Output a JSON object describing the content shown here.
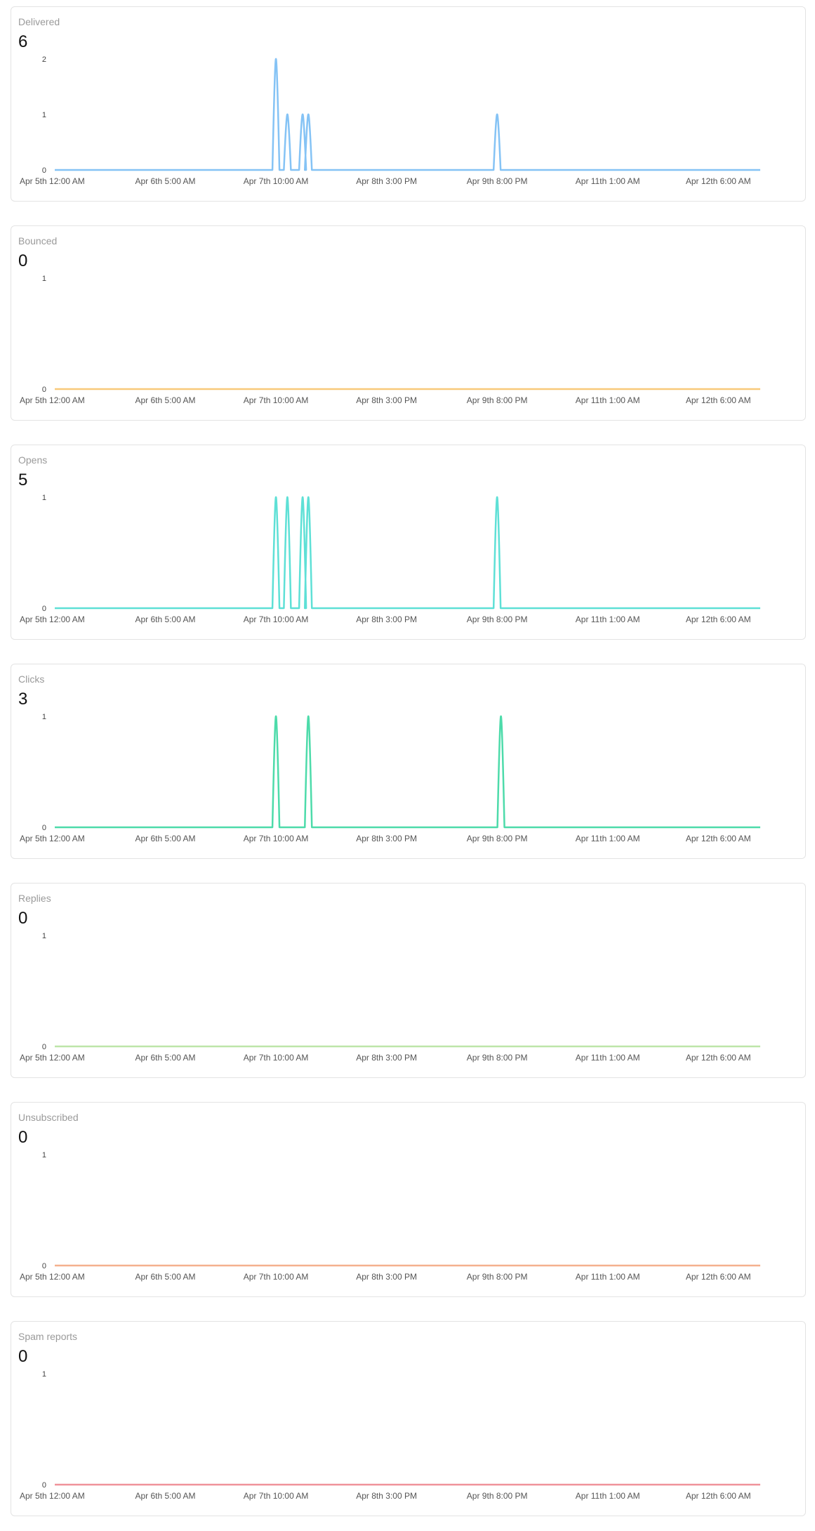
{
  "chart_data": [
    {
      "type": "line",
      "title": "Delivered",
      "total": "6",
      "color": "#85c3f5",
      "x_ticks": [
        "Apr 5th 12:00 AM",
        "Apr 6th 5:00 AM",
        "Apr 7th 10:00 AM",
        "Apr 8th 3:00 PM",
        "Apr 9th 8:00 PM",
        "Apr 11th 1:00 AM",
        "Apr 12th 6:00 AM"
      ],
      "y_ticks": [
        "0",
        "1",
        "2"
      ],
      "ylim": [
        0,
        2
      ],
      "xlim": [
        "Apr 5th 12:00 AM",
        "Apr 12th 5:00 PM"
      ],
      "points": [
        {
          "x": "Apr 7th 10:00 AM",
          "y": 2
        },
        {
          "x": "Apr 7th 1:00 PM",
          "y": 1
        },
        {
          "x": "Apr 7th 5:00 PM",
          "y": 1
        },
        {
          "x": "Apr 7th 6:30 PM",
          "y": 1
        },
        {
          "x": "Apr 9th 8:00 PM",
          "y": 1
        }
      ]
    },
    {
      "type": "line",
      "title": "Bounced",
      "total": "0",
      "color": "#f8c97a",
      "x_ticks": [
        "Apr 5th 12:00 AM",
        "Apr 6th 5:00 AM",
        "Apr 7th 10:00 AM",
        "Apr 8th 3:00 PM",
        "Apr 9th 8:00 PM",
        "Apr 11th 1:00 AM",
        "Apr 12th 6:00 AM"
      ],
      "y_ticks": [
        "0",
        "1"
      ],
      "ylim": [
        0,
        1
      ],
      "xlim": [
        "Apr 5th 12:00 AM",
        "Apr 12th 5:00 PM"
      ],
      "points": []
    },
    {
      "type": "line",
      "title": "Opens",
      "total": "5",
      "color": "#5ee0d6",
      "x_ticks": [
        "Apr 5th 12:00 AM",
        "Apr 6th 5:00 AM",
        "Apr 7th 10:00 AM",
        "Apr 8th 3:00 PM",
        "Apr 9th 8:00 PM",
        "Apr 11th 1:00 AM",
        "Apr 12th 6:00 AM"
      ],
      "y_ticks": [
        "0",
        "1"
      ],
      "ylim": [
        0,
        1
      ],
      "xlim": [
        "Apr 5th 12:00 AM",
        "Apr 12th 5:00 PM"
      ],
      "points": [
        {
          "x": "Apr 7th 10:00 AM",
          "y": 1
        },
        {
          "x": "Apr 7th 1:00 PM",
          "y": 1
        },
        {
          "x": "Apr 7th 5:00 PM",
          "y": 1
        },
        {
          "x": "Apr 7th 6:30 PM",
          "y": 1
        },
        {
          "x": "Apr 9th 8:00 PM",
          "y": 1
        }
      ]
    },
    {
      "type": "line",
      "title": "Clicks",
      "total": "3",
      "color": "#4ddbaa",
      "x_ticks": [
        "Apr 5th 12:00 AM",
        "Apr 6th 5:00 AM",
        "Apr 7th 10:00 AM",
        "Apr 8th 3:00 PM",
        "Apr 9th 8:00 PM",
        "Apr 11th 1:00 AM",
        "Apr 12th 6:00 AM"
      ],
      "y_ticks": [
        "0",
        "1"
      ],
      "ylim": [
        0,
        1
      ],
      "xlim": [
        "Apr 5th 12:00 AM",
        "Apr 12th 5:00 PM"
      ],
      "points": [
        {
          "x": "Apr 7th 10:00 AM",
          "y": 1
        },
        {
          "x": "Apr 7th 6:30 PM",
          "y": 1
        },
        {
          "x": "Apr 9th 9:00 PM",
          "y": 1
        }
      ]
    },
    {
      "type": "line",
      "title": "Replies",
      "total": "0",
      "color": "#bde5a8",
      "x_ticks": [
        "Apr 5th 12:00 AM",
        "Apr 6th 5:00 AM",
        "Apr 7th 10:00 AM",
        "Apr 8th 3:00 PM",
        "Apr 9th 8:00 PM",
        "Apr 11th 1:00 AM",
        "Apr 12th 6:00 AM"
      ],
      "y_ticks": [
        "0",
        "1"
      ],
      "ylim": [
        0,
        1
      ],
      "xlim": [
        "Apr 5th 12:00 AM",
        "Apr 12th 5:00 PM"
      ],
      "points": []
    },
    {
      "type": "line",
      "title": "Unsubscribed",
      "total": "0",
      "color": "#f5b08e",
      "x_ticks": [
        "Apr 5th 12:00 AM",
        "Apr 6th 5:00 AM",
        "Apr 7th 10:00 AM",
        "Apr 8th 3:00 PM",
        "Apr 9th 8:00 PM",
        "Apr 11th 1:00 AM",
        "Apr 12th 6:00 AM"
      ],
      "y_ticks": [
        "0",
        "1"
      ],
      "ylim": [
        0,
        1
      ],
      "xlim": [
        "Apr 5th 12:00 AM",
        "Apr 12th 5:00 PM"
      ],
      "points": []
    },
    {
      "type": "line",
      "title": "Spam reports",
      "total": "0",
      "color": "#f0929a",
      "x_ticks": [
        "Apr 5th 12:00 AM",
        "Apr 6th 5:00 AM",
        "Apr 7th 10:00 AM",
        "Apr 8th 3:00 PM",
        "Apr 9th 8:00 PM",
        "Apr 11th 1:00 AM",
        "Apr 12th 6:00 AM"
      ],
      "y_ticks": [
        "0",
        "1"
      ],
      "ylim": [
        0,
        1
      ],
      "xlim": [
        "Apr 5th 12:00 AM",
        "Apr 12th 5:00 PM"
      ],
      "points": []
    }
  ]
}
